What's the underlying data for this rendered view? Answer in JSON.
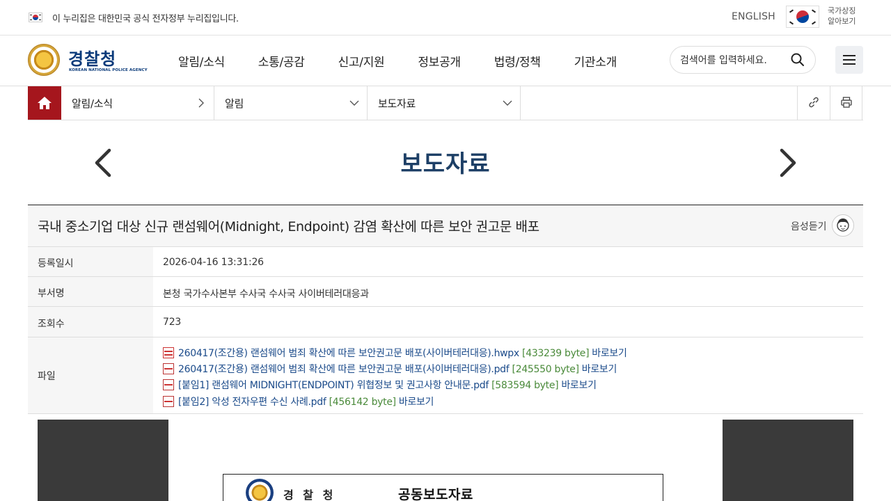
{
  "gov_bar": {
    "notice": "이 누리집은 대한민국 공식 전자정부 누리집입니다.",
    "english": "ENGLISH",
    "symbol_line1": "국가상징",
    "symbol_line2": "알아보기"
  },
  "header": {
    "logo_title": "경찰청",
    "logo_sub": "KOREAN NATIONAL POLICE AGENCY",
    "nav": [
      "알림/소식",
      "소통/공감",
      "신고/지원",
      "정보공개",
      "법령/정책",
      "기관소개"
    ],
    "search_placeholder": "검색어를 입력하세요."
  },
  "breadcrumb": {
    "level1": "알림/소식",
    "level2": "알림",
    "level3": "보도자료"
  },
  "page": {
    "title": "보도자료"
  },
  "article": {
    "title": "국내 중소기업 대상 신규 랜섬웨어(Midnight, Endpoint) 감염 확산에 따른 보안 권고문 배포",
    "tts_label": "음성듣기",
    "rows": {
      "date_label": "등록일시",
      "date_value": "2026-04-16 13:31:26",
      "dept_label": "부서명",
      "dept_value": "본청 국가수사본부 수사국 수사국 사이버테러대응과",
      "views_label": "조회수",
      "views_value": "723",
      "file_label": "파일"
    },
    "files": [
      {
        "name": "260417(조간용) 랜섬웨어 범죄 확산에 따른 보안권고문 배포(사이버테러대응).hwpx",
        "size": "[433239 byte]",
        "view": "바로보기",
        "type": "hwp"
      },
      {
        "name": "260417(조간용) 랜섬웨어 범죄 확산에 따른 보안권고문 배포(사이버테러대응).pdf",
        "size": "[245550 byte]",
        "view": "바로보기",
        "type": "pdf"
      },
      {
        "name": "[붙임1] 랜섬웨어 MIDNIGHT(ENDPOINT) 위협정보 및 권고사항 안내문.pdf",
        "size": "[583594 byte]",
        "view": "바로보기",
        "type": "pdf"
      },
      {
        "name": "[붙임2] 악성 전자우편 수신 사례.pdf",
        "size": "[456142 byte]",
        "view": "바로보기",
        "type": "pdf"
      }
    ]
  },
  "document": {
    "org": "경 찰 청",
    "type": "공동보도자료"
  },
  "colors": {
    "brand_navy": "#1d3f66",
    "home_red": "#a5161d",
    "link_blue": "#1a4a8a",
    "size_green": "#4a8a3a"
  }
}
